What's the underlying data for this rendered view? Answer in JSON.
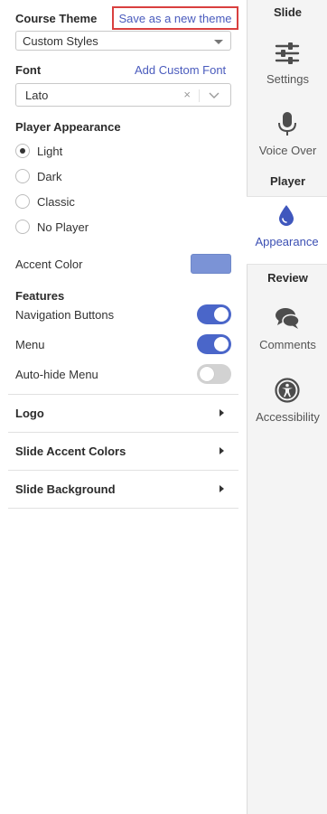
{
  "course_theme": {
    "label": "Course Theme",
    "save_link": "Save as a new theme",
    "selected": "Custom Styles"
  },
  "font": {
    "label": "Font",
    "add_link": "Add Custom Font",
    "selected": "Lato",
    "clear_glyph": "×"
  },
  "player_appearance": {
    "label": "Player Appearance",
    "options": [
      "Light",
      "Dark",
      "Classic",
      "No Player"
    ],
    "selected_index": 0
  },
  "accent": {
    "label": "Accent Color",
    "color": "#7b93d6"
  },
  "features": {
    "label": "Features",
    "items": [
      {
        "label": "Navigation Buttons",
        "on": true
      },
      {
        "label": "Menu",
        "on": true
      },
      {
        "label": "Auto-hide Menu",
        "on": false
      }
    ]
  },
  "sections": [
    "Logo",
    "Slide Accent Colors",
    "Slide Background"
  ],
  "rail": {
    "slide_group": "Slide",
    "settings": "Settings",
    "voice_over": "Voice Over",
    "player_group": "Player",
    "appearance": "Appearance",
    "review_group": "Review",
    "comments": "Comments",
    "accessibility": "Accessibility",
    "active_item": "Appearance",
    "icons": {
      "settings": "sliders-icon",
      "voice_over": "microphone-icon",
      "appearance": "droplet-icon",
      "comments": "chat-bubbles-icon",
      "accessibility": "accessibility-person-icon"
    }
  },
  "colors": {
    "brand_blue": "#4a66c9",
    "link": "#4a5bbd",
    "highlight_border": "#d9403f",
    "toggle_off": "#d2d2d2"
  }
}
